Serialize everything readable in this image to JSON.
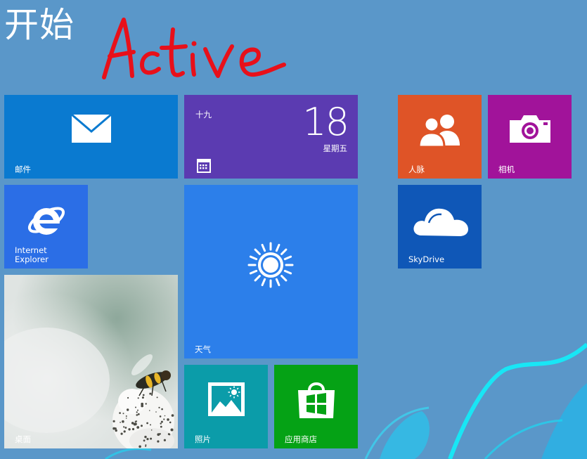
{
  "start": {
    "title": "开始",
    "annotation": "Active"
  },
  "colors": {
    "background": "#5a97c9",
    "annotation_ink": "#e8101a",
    "swoosh": "#18e6f5"
  },
  "tiles": {
    "mail": {
      "label": "邮件",
      "icon": "envelope-icon",
      "color": "#0a7ad0"
    },
    "calendar": {
      "day_text": "十九",
      "date": "18",
      "weekday": "星期五",
      "icon": "calendar-icon",
      "color": "#5b3bb1"
    },
    "people": {
      "label": "人脉",
      "icon": "people-icon",
      "color": "#df5427"
    },
    "camera": {
      "label": "相机",
      "icon": "camera-icon",
      "color": "#a1139a"
    },
    "ie": {
      "label": "Internet Explorer",
      "icon": "internet-explorer-icon",
      "color": "#2b6ee6"
    },
    "weather": {
      "label": "天气",
      "icon": "sun-icon",
      "color": "#2c7fea"
    },
    "skydrive": {
      "label": "SkyDrive",
      "icon": "cloud-icon",
      "color": "#0f57b7"
    },
    "desktop": {
      "label": "桌面",
      "icon": "desktop-wallpaper-image"
    },
    "photos": {
      "label": "照片",
      "icon": "photo-icon",
      "color": "#0b9ca9"
    },
    "store": {
      "label": "应用商店",
      "icon": "store-bag-icon",
      "color": "#05a215"
    }
  }
}
